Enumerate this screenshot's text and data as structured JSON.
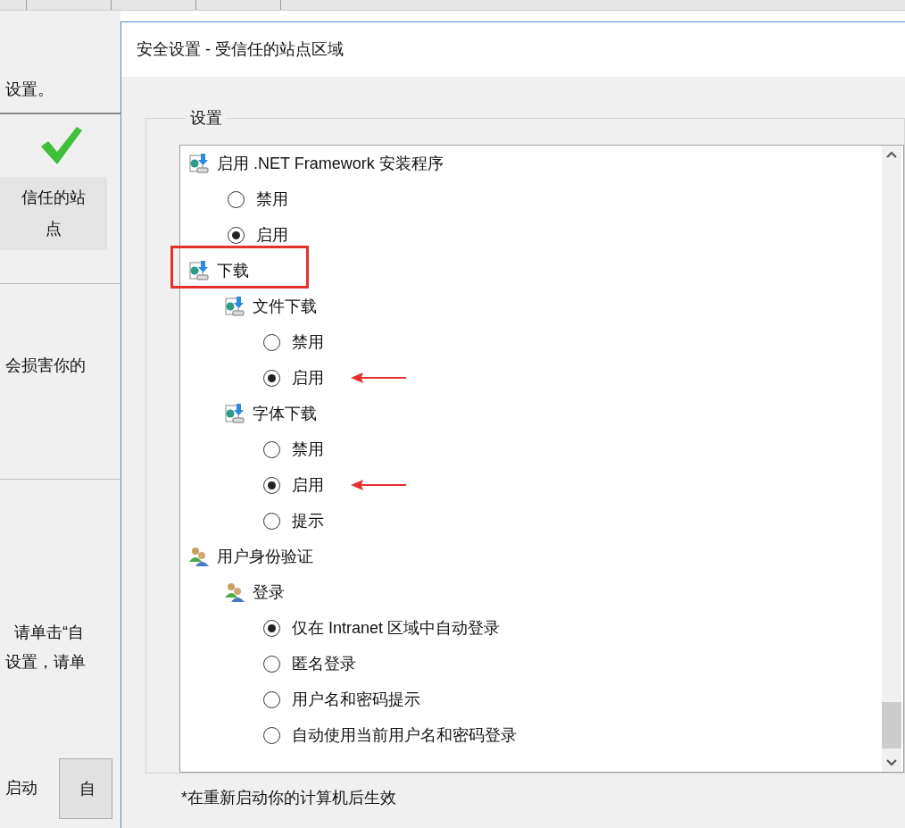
{
  "background_window": {
    "heading_fragment": "设置。",
    "zone_label": "信任的站点",
    "text_1": "会损害你的",
    "text_2": "请单击“自",
    "text_3": "设置，请单",
    "text_4": "启动",
    "button": "自"
  },
  "dialog": {
    "title": "安全设置 - 受信任的站点区域",
    "group_label": "设置",
    "settings": [
      {
        "kind": "download_group",
        "label": "启用 .NET Framework 安装程序",
        "highlighted": false,
        "children": [
          {
            "kind": "option",
            "label": "禁用",
            "selected": false,
            "arrow": false
          },
          {
            "kind": "option",
            "label": "启用",
            "selected": true,
            "arrow": false
          }
        ]
      },
      {
        "kind": "download_group",
        "label": "下载",
        "highlighted": true,
        "children": [
          {
            "kind": "download_group",
            "label": "文件下载",
            "highlighted": false,
            "children": [
              {
                "kind": "option",
                "label": "禁用",
                "selected": false,
                "arrow": false
              },
              {
                "kind": "option",
                "label": "启用",
                "selected": true,
                "arrow": true
              }
            ]
          },
          {
            "kind": "download_group",
            "label": "字体下载",
            "highlighted": false,
            "children": [
              {
                "kind": "option",
                "label": "禁用",
                "selected": false,
                "arrow": false
              },
              {
                "kind": "option",
                "label": "启用",
                "selected": true,
                "arrow": true
              },
              {
                "kind": "option",
                "label": "提示",
                "selected": false,
                "arrow": false
              }
            ]
          }
        ]
      },
      {
        "kind": "user_group",
        "label": "用户身份验证",
        "highlighted": false,
        "children": [
          {
            "kind": "user_group",
            "label": "登录",
            "highlighted": false,
            "children": [
              {
                "kind": "option",
                "label": "仅在 Intranet 区域中自动登录",
                "selected": true,
                "arrow": false
              },
              {
                "kind": "option",
                "label": "匿名登录",
                "selected": false,
                "arrow": false
              },
              {
                "kind": "option",
                "label": "用户名和密码提示",
                "selected": false,
                "arrow": false
              },
              {
                "kind": "option",
                "label": "自动使用当前用户名和密码登录",
                "selected": false,
                "arrow": false
              }
            ]
          }
        ]
      }
    ],
    "footnote": "*在重新启动你的计算机后生效"
  }
}
